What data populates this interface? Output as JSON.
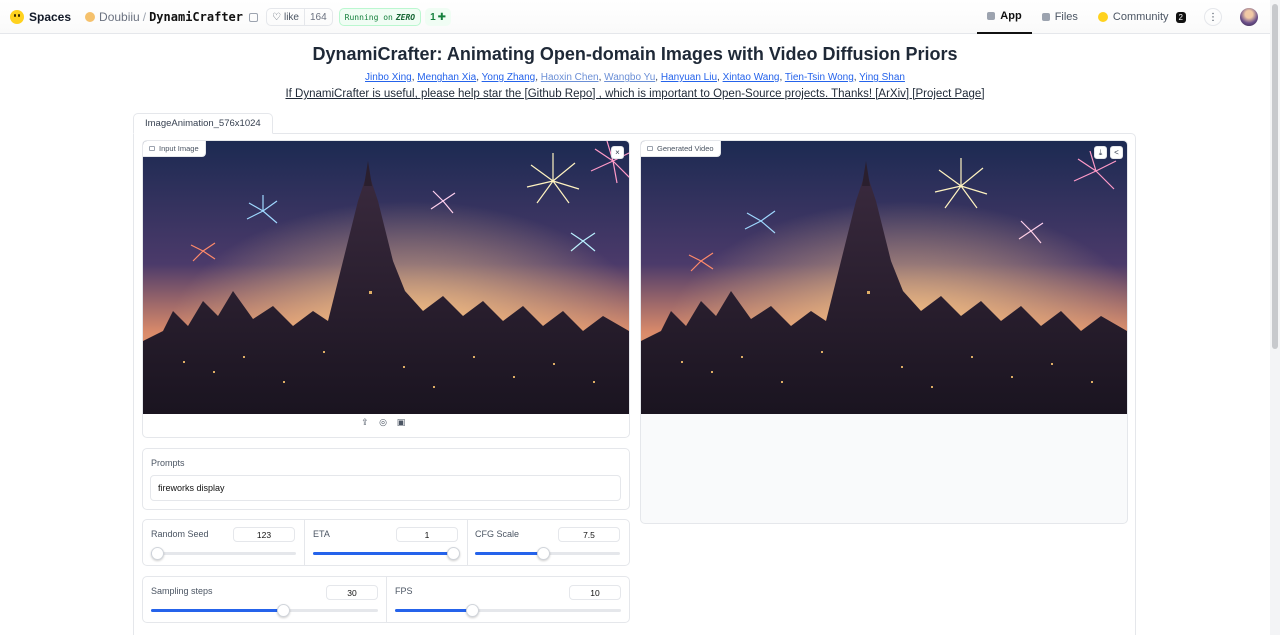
{
  "topbar": {
    "spaces_label": "Spaces",
    "owner": "Doubiiu",
    "separator": "/",
    "repo": "DynamiCrafter",
    "like_label": "like",
    "like_count": "164",
    "running_label": "Running on",
    "running_hw": "ZERO",
    "plus_label": "1",
    "nav": {
      "app": "App",
      "files": "Files",
      "community": "Community",
      "community_count": "2"
    },
    "more_label": "⋮"
  },
  "page": {
    "title": "DynamiCrafter: Animating Open-domain Images with Video Diffusion Priors",
    "authors": [
      {
        "name": "Jinbo Xing",
        "visited": false
      },
      {
        "name": "Menghan Xia",
        "visited": false
      },
      {
        "name": "Yong Zhang",
        "visited": false
      },
      {
        "name": "Haoxin Chen",
        "visited": true
      },
      {
        "name": "Wangbo Yu",
        "visited": true
      },
      {
        "name": "Hanyuan Liu",
        "visited": false
      },
      {
        "name": "Xintao Wang",
        "visited": false
      },
      {
        "name": "Tien-Tsin Wong",
        "visited": false
      },
      {
        "name": "Ying Shan",
        "visited": false
      }
    ],
    "author_sep": ", ",
    "notice": "If DynamiCrafter is useful, please help star the [Github Repo] , which is important to Open-Source projects. Thanks! [ArXiv] [Project Page]"
  },
  "tab": {
    "label": "ImageAnimation_576x1024"
  },
  "input_image": {
    "label": "Input Image",
    "close": "×"
  },
  "generated_video": {
    "label": "Generated Video",
    "download": "⤓",
    "share": "<"
  },
  "prompts": {
    "label": "Prompts",
    "value": "fireworks display"
  },
  "sliders": {
    "seed": {
      "label": "Random Seed",
      "value": "123",
      "fraction": 0.04
    },
    "eta": {
      "label": "ETA",
      "value": "1",
      "fraction": 1.0
    },
    "cfg": {
      "label": "CFG Scale",
      "value": "7.5",
      "fraction": 0.47
    },
    "steps": {
      "label": "Sampling steps",
      "value": "30",
      "fraction": 0.58
    },
    "fps": {
      "label": "FPS",
      "value": "10",
      "fraction": 0.34
    }
  },
  "colors": {
    "accent": "#2563eb",
    "running_green": "#15803d",
    "hf_yellow": "#ffd21e"
  }
}
